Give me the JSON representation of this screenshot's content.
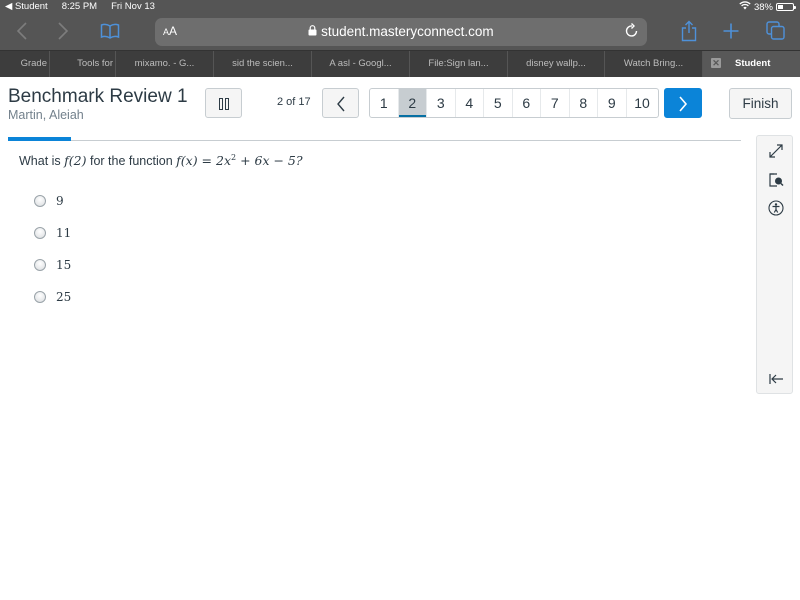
{
  "status_bar": {
    "back_app": "◀ Student",
    "time": "8:25 PM",
    "date": "Fri Nov 13",
    "battery_percent": "38%",
    "battery_level": 0.38
  },
  "browser": {
    "text_size_label_small": "A",
    "text_size_label_large": "A",
    "url": "student.masteryconnect.com",
    "icons": {
      "back": "chevron-left-icon",
      "forward": "chevron-right-icon",
      "bookmarks": "book-icon",
      "lock": "lock-icon",
      "reload": "reload-icon",
      "share": "share-icon",
      "new_tab": "plus-icon",
      "tabs": "tabs-icon"
    },
    "tabs": [
      {
        "label": "Grade"
      },
      {
        "label": "Tools for"
      },
      {
        "label": "mixamo. - G..."
      },
      {
        "label": "sid the scien..."
      },
      {
        "label": "A asl - Googl..."
      },
      {
        "label": "File:Sign lan..."
      },
      {
        "label": "disney wallp..."
      },
      {
        "label": "Watch Bring..."
      },
      {
        "label": "Student",
        "active": true
      }
    ]
  },
  "assessment": {
    "title": "Benchmark Review 1",
    "student": "Martin, Aleiah",
    "counter": "2 of 17",
    "current_question": 2,
    "total_questions": 17,
    "progress_fraction": 0.118,
    "pages": [
      "1",
      "2",
      "3",
      "4",
      "5",
      "6",
      "7",
      "8",
      "9",
      "10"
    ],
    "prev_glyph": "‹",
    "next_glyph": "›",
    "finish_label": "Finish",
    "accent_color": "#0b84d8"
  },
  "question": {
    "prefix": "What is ",
    "f_of_2": "f(2)",
    "middle": " for the function ",
    "function_lhs": "f(x) = 2x",
    "exponent": "2",
    "function_rhs": " + 6x − 5?",
    "choices": [
      "9",
      "11",
      "15",
      "25"
    ]
  },
  "tools": {
    "expand": "expand-icon",
    "magnifier": "magnifier-icon",
    "accessibility": "accessibility-icon",
    "collapse": "collapse-panel-icon"
  }
}
